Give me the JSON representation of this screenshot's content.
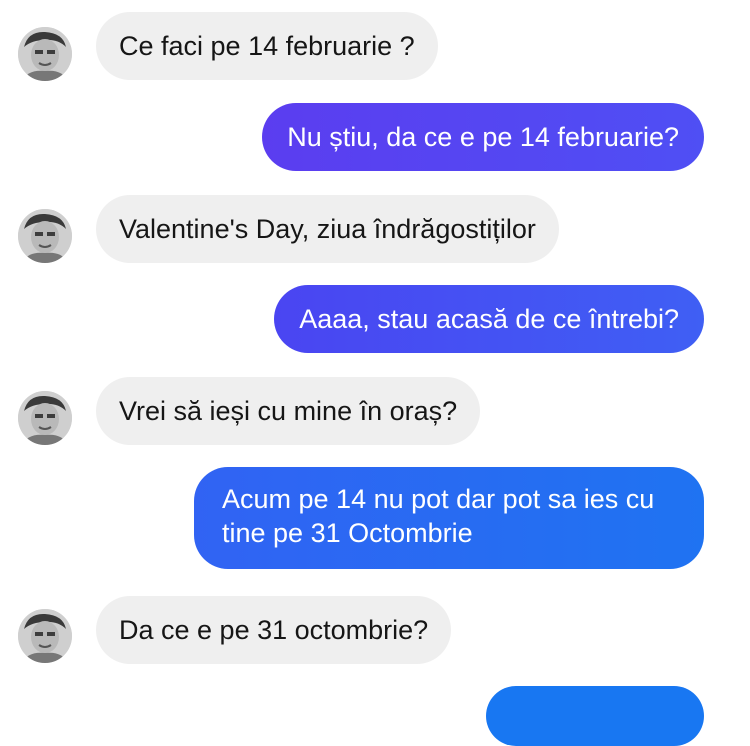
{
  "colors": {
    "incoming_bubble": "#efefef",
    "incoming_text": "#161616",
    "outgoing_start": "#5b3df0",
    "outgoing_end": "#1877f2"
  },
  "conversation": {
    "messages": [
      {
        "from": "them",
        "avatar_icon": "person-photo-icon",
        "text": "Ce faci pe 14 februarie ?"
      },
      {
        "from": "me",
        "text": "Nu știu, da ce e pe 14 februarie?"
      },
      {
        "from": "them",
        "avatar_icon": "person-photo-icon",
        "text": "Valentine's Day, ziua îndrăgostiților"
      },
      {
        "from": "me",
        "text": "Aaaa, stau acasă de ce întrebi?"
      },
      {
        "from": "them",
        "avatar_icon": "person-photo-icon",
        "text": "Vrei să ieși cu mine în oraș?"
      },
      {
        "from": "me",
        "text": "Acum pe 14 nu pot dar pot sa ies cu tine pe 31 Octombrie"
      },
      {
        "from": "them",
        "avatar_icon": "person-photo-icon",
        "text": "Da ce e pe 31 octombrie?"
      }
    ]
  }
}
